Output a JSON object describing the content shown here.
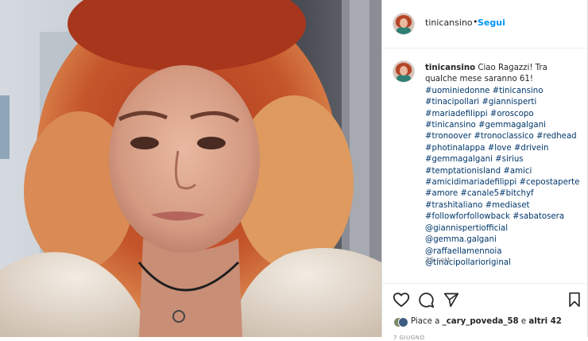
{
  "header": {
    "username": "tinicansino",
    "separator": "•",
    "follow_label": "Segui"
  },
  "caption": {
    "username": "tinicansino",
    "text": "Ciao Ragazzi! Tra qualche mese saranno 61!",
    "tags": [
      "#uominiedonne #tinicansino",
      "#tinacipollari #giannisperti",
      "#mariadefilippi #oroscopo",
      "#tinicansino #gemmagalgani",
      "#tronoover #tronoclassico #redhead",
      "#photinalappa #love #drivein",
      "#gemmagalgani #sirius",
      "#temptationisland #amici",
      "#amicidimariadefilippi #cepostaperte",
      "#amore #canale5#bitchyf",
      "#trashitaliano #mediaset",
      "#followforfollowback #sabatosera",
      "@giannispertiofficial @gemma.galgani",
      "@raffaellamennoia",
      "@tinacipollarioriginal"
    ]
  },
  "timestamp": "25 sett.",
  "actions": {
    "like_icon": "heart-icon",
    "comment_icon": "comment-icon",
    "share_icon": "paper-plane-icon",
    "save_icon": "bookmark-icon"
  },
  "likes": {
    "prefix": "Piace a",
    "user": "_cary_poveda_58",
    "middle": "e",
    "others": "altri 42"
  },
  "post_date": "7 GIUGNO",
  "colors": {
    "link_blue": "#0095f6",
    "hashtag_blue": "#00376b",
    "text": "#262626",
    "muted": "#8e8e8e",
    "hair": "#c0502c"
  }
}
